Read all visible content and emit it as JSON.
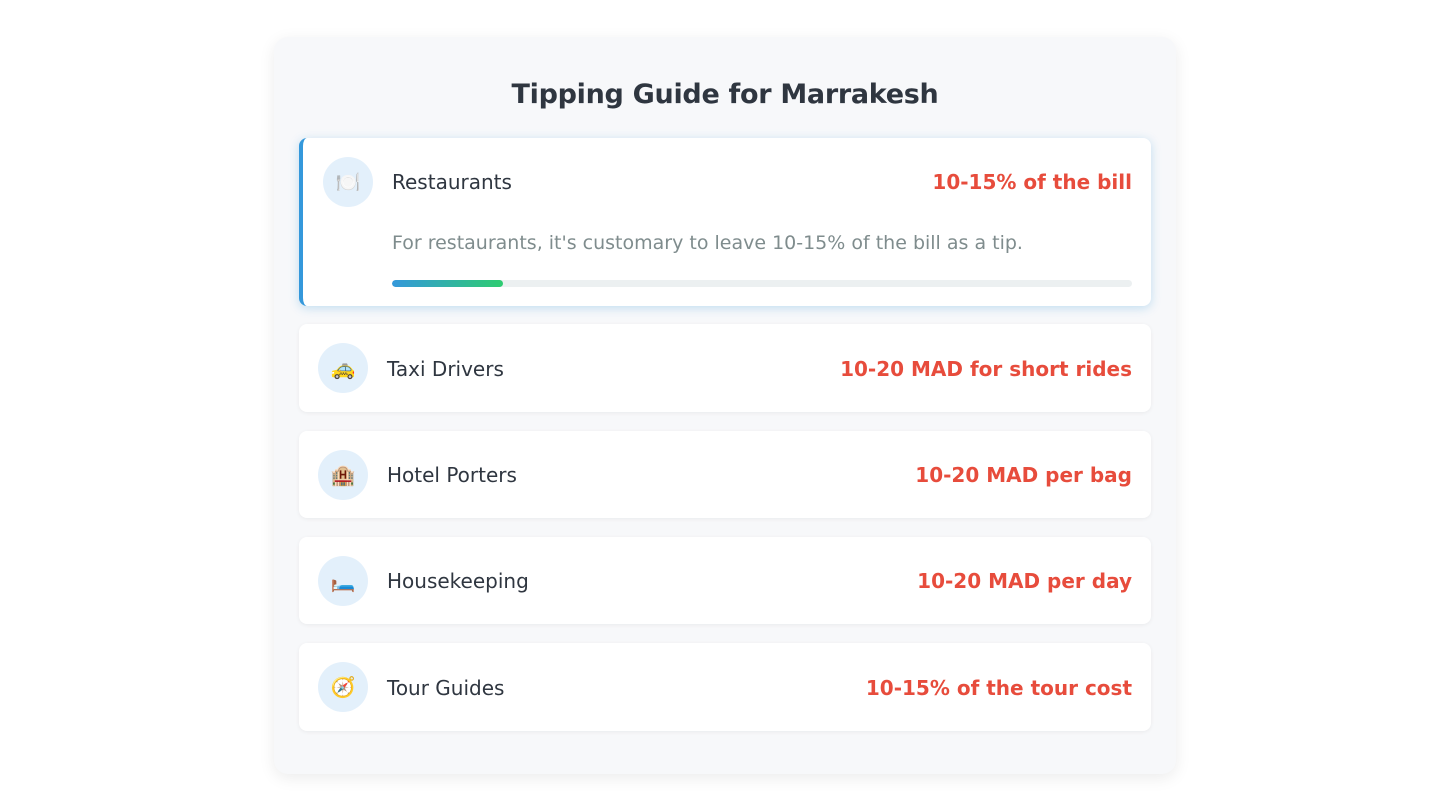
{
  "title": "Tipping Guide for Marrakesh",
  "colors": {
    "accent": "#3498db",
    "amount": "#e74c3c",
    "progress_start": "#3498db",
    "progress_end": "#2ecc71"
  },
  "items": [
    {
      "label": "Restaurants",
      "amount": "10-15% of the bill",
      "icon": "🍽️",
      "icon_name": "plate-cutlery-icon",
      "expanded": true,
      "description": "For restaurants, it's customary to leave 10-15% of the bill as a tip.",
      "progress_fraction": 0.15
    },
    {
      "label": "Taxi Drivers",
      "amount": "10-20 MAD for short rides",
      "icon": "🚕",
      "icon_name": "taxi-icon",
      "expanded": false
    },
    {
      "label": "Hotel Porters",
      "amount": "10-20 MAD per bag",
      "icon": "🏨",
      "icon_name": "hotel-icon",
      "expanded": false
    },
    {
      "label": "Housekeeping",
      "amount": "10-20 MAD per day",
      "icon": "🛏️",
      "icon_name": "bed-icon",
      "expanded": false
    },
    {
      "label": "Tour Guides",
      "amount": "10-15% of the tour cost",
      "icon": "🧭",
      "icon_name": "compass-icon",
      "expanded": false
    }
  ]
}
